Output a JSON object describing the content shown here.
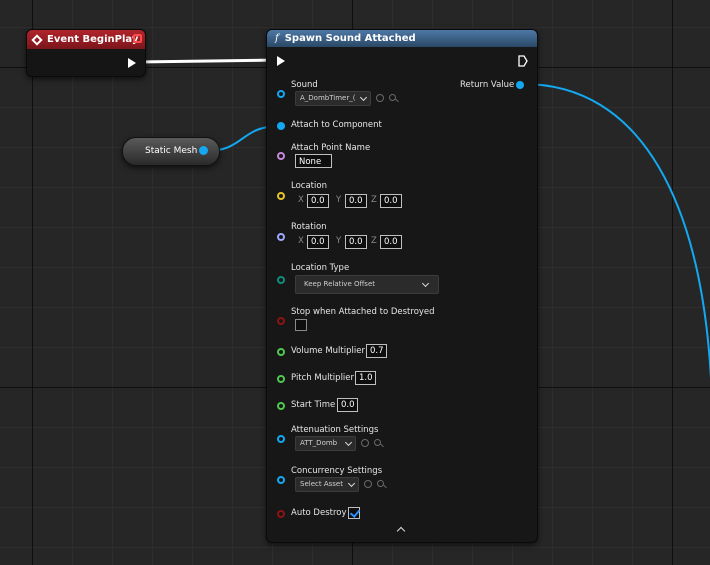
{
  "event_node": {
    "title": "Event BeginPlay"
  },
  "variable_node": {
    "label": "Static Mesh"
  },
  "function_node": {
    "title": "Spawn Sound Attached",
    "return_value_label": "Return Value",
    "sound": {
      "label": "Sound",
      "value": "A_DombTimer_("
    },
    "attach_to_component": {
      "label": "Attach to Component"
    },
    "attach_point_name": {
      "label": "Attach Point Name",
      "value": "None"
    },
    "location": {
      "label": "Location",
      "x_axis": "X",
      "y_axis": "Y",
      "z_axis": "Z",
      "x": "0.0",
      "y": "0.0",
      "z": "0.0"
    },
    "rotation": {
      "label": "Rotation",
      "x_axis": "X",
      "y_axis": "Y",
      "z_axis": "Z",
      "x": "0.0",
      "y": "0.0",
      "z": "0.0"
    },
    "location_type": {
      "label": "Location Type",
      "value": "Keep Relative Offset"
    },
    "stop_when_attached": {
      "label": "Stop when Attached to Destroyed",
      "checked": false
    },
    "volume_multiplier": {
      "label": "Volume Multiplier",
      "value": "0.7"
    },
    "pitch_multiplier": {
      "label": "Pitch Multiplier",
      "value": "1.0"
    },
    "start_time": {
      "label": "Start Time",
      "value": "0.0"
    },
    "attenuation_settings": {
      "label": "Attenuation Settings",
      "value": "ATT_Domb"
    },
    "concurrency_settings": {
      "label": "Concurrency Settings",
      "value": "Select Asset"
    },
    "auto_destroy": {
      "label": "Auto Destroy",
      "checked": true
    }
  },
  "colors": {
    "event_header": "#b1242c",
    "function_header": "#4d78a6",
    "object_pin": "#14a8f0",
    "name_pin": "#c58adc",
    "vector_pin": "#e8c22a",
    "rotator_pin": "#9ea8ff",
    "enum_pin": "#118c7e",
    "bool_pin": "#8b1414",
    "float_pin": "#4ec94e"
  }
}
